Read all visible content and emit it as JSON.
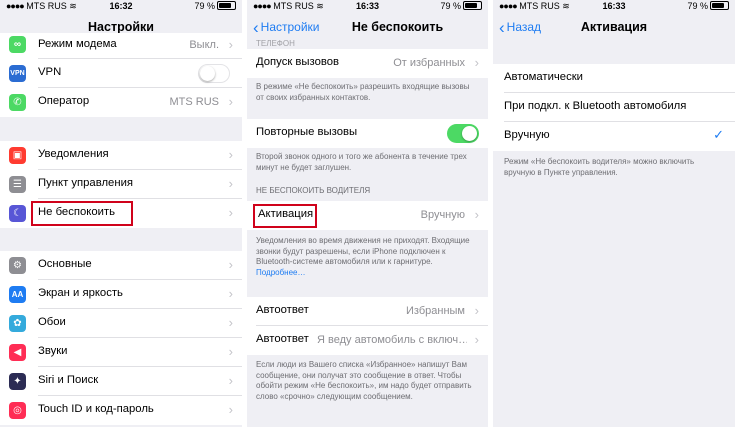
{
  "status": {
    "carrier": "MTS RUS",
    "time": "16:32",
    "time2": "16:33",
    "battery": "79 %"
  },
  "colors": {
    "accent": "#1e7cf2",
    "highlight": "#d0021b",
    "toggle_on": "#4cd964"
  },
  "panel1": {
    "title": "Настройки",
    "rows": [
      {
        "label": "Режим модема",
        "value": "Выкл.",
        "icon": "chain-icon",
        "color": "#4cd964"
      },
      {
        "label": "VPN",
        "icon": "vpn-icon",
        "color": "#2b6cd2",
        "toggle": "off"
      },
      {
        "label": "Оператор",
        "value": "MTS RUS",
        "icon": "phone-icon",
        "color": "#4cd964"
      },
      {
        "label": "Уведомления",
        "icon": "notifications-icon",
        "color": "#ff3b30"
      },
      {
        "label": "Пункт управления",
        "icon": "control-center-icon",
        "color": "#8e8e93"
      },
      {
        "label": "Не беспокоить",
        "icon": "moon-icon",
        "color": "#5856d6"
      },
      {
        "label": "Основные",
        "icon": "gear-icon",
        "color": "#8e8e93"
      },
      {
        "label": "Экран и яркость",
        "icon": "display-brightness-icon",
        "color": "#1e7cf2"
      },
      {
        "label": "Обои",
        "icon": "wallpaper-icon",
        "color": "#34aadc"
      },
      {
        "label": "Звуки",
        "icon": "sound-icon",
        "color": "#ff2d55"
      },
      {
        "label": "Siri и Поиск",
        "icon": "siri-icon",
        "color": "#2c2c54"
      },
      {
        "label": "Touch ID и код-пароль",
        "icon": "fingerprint-icon",
        "color": "#ff2d55"
      }
    ]
  },
  "panel2": {
    "back": "Настройки",
    "title": "Не беспокоить",
    "partial_header": "ТЕЛЕФОН",
    "allow_calls": {
      "label": "Допуск вызовов",
      "value": "От избранных"
    },
    "allow_calls_note": "В режиме «Не беспокоить» разрешить входящие вызовы от своих избранных контактов.",
    "repeated": {
      "label": "Повторные вызовы"
    },
    "repeated_note": "Второй звонок одного и того же абонента в течение трех минут не будет заглушен.",
    "driving_header": "НЕ БЕСПОКОИТЬ ВОДИТЕЛЯ",
    "activation": {
      "label": "Активация",
      "value": "Вручную"
    },
    "activation_note": "Уведомления во время движения не приходят. Входящие звонки будут разрешены, если iPhone подключен к Bluetooth-системе автомобиля или к гарнитуре.",
    "more_link": "Подробнее…",
    "autoreply_to": {
      "label": "Автоответ",
      "value": "Избранным"
    },
    "autoreply": {
      "label": "Автоответ",
      "value": "Я веду автомобиль с включ…"
    },
    "autoreply_note": "Если люди из Вашего списка «Избранное» напишут Вам сообщение, они получат это сообщение в ответ. Чтобы обойти режим «Не беспокоить», им надо будет отправить слово «срочно» следующим сообщением."
  },
  "panel3": {
    "back": "Назад",
    "title": "Активация",
    "options": [
      {
        "label": "Автоматически"
      },
      {
        "label": "При подкл. к Bluetooth автомобиля"
      },
      {
        "label": "Вручную",
        "selected": true
      }
    ],
    "note": "Режим «Не беспокоить водителя» можно включить вручную в Пункте управления."
  }
}
